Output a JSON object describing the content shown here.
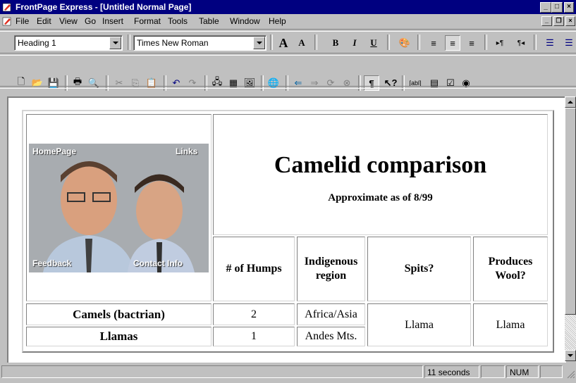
{
  "window": {
    "title": "FrontPage Express - [Untitled Normal Page]",
    "caption_buttons": [
      "minimize",
      "maximize",
      "close"
    ]
  },
  "menu": [
    "File",
    "Edit",
    "View",
    "Go",
    "Insert",
    "Format",
    "Tools",
    "Table",
    "Window",
    "Help"
  ],
  "format_toolbar": {
    "style_value": "Heading 1",
    "font_value": "Times New Roman",
    "icons": [
      "increase-text-size-icon",
      "decrease-text-size-icon",
      "bold-icon",
      "italic-icon",
      "underline-icon",
      "text-color-icon",
      "align-left-icon",
      "align-center-icon",
      "align-right-icon",
      "ltr-icon",
      "rtl-icon",
      "numbered-list-icon",
      "bulleted-list-icon"
    ],
    "bold": "B",
    "italic": "I",
    "underline": "U"
  },
  "standard_toolbar": {
    "icons": [
      "new-icon",
      "open-icon",
      "save-icon",
      "print-icon",
      "print-preview-icon",
      "cut-icon",
      "copy-icon",
      "paste-icon",
      "undo-icon",
      "redo-icon",
      "webbot-icon",
      "table-icon",
      "image-icon",
      "hyperlink-icon",
      "back-icon",
      "forward-icon",
      "refresh-icon",
      "stop-icon",
      "paragraph-marks-icon",
      "help-icon",
      "textbox-icon",
      "listbox-icon",
      "checkbox-icon",
      "radio-icon"
    ]
  },
  "document": {
    "heading": "Camelid comparison",
    "subheading": "Approximate as of 8/99",
    "photo_labels": {
      "top_left": "HomePage",
      "top_right": "Links",
      "bottom_left": "Feedback",
      "bottom_right": "Contact Info"
    },
    "columns": [
      "# of Humps",
      "Indigenous region",
      "Spits?",
      "Produces Wool?"
    ],
    "rows": [
      {
        "name": "Camels (bactrian)",
        "humps": "2",
        "region": "Africa/Asia"
      },
      {
        "name": "Llamas",
        "humps": "1",
        "region": "Andes Mts."
      }
    ],
    "spits_value": "Llama",
    "wool_value": "Llama"
  },
  "status": {
    "time": "11 seconds",
    "num": "NUM"
  },
  "colors": {
    "titlebar": "#000080",
    "face": "#c0c0c0"
  }
}
